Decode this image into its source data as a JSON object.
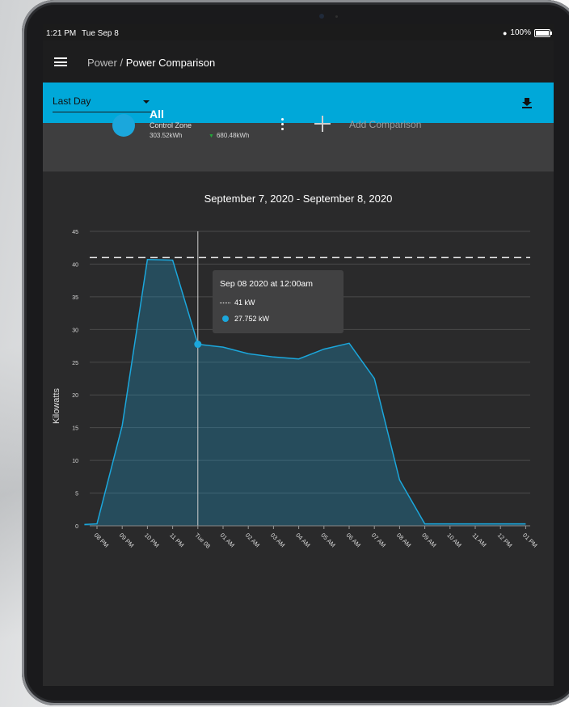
{
  "status": {
    "time": "1:21 PM",
    "date": "Tue Sep 8",
    "battery": "100%"
  },
  "appbar": {
    "section": "Power /",
    "page": "Power Comparison"
  },
  "filter": {
    "range_selected": "Last Day"
  },
  "comparison": {
    "zone_name": "All",
    "zone_type": "Control Zone",
    "energy": "303.52kWh",
    "trend_value": "680.48kWh",
    "add_label": "Add Comparison"
  },
  "colors": {
    "accent": "#00a8d9",
    "series": "#1ba7dc",
    "trend_down": "#22a63a",
    "background": "#2a2a2b"
  },
  "icons": [
    "menu-icon",
    "chevron-down-icon",
    "download-icon",
    "more-vertical-icon",
    "plus-icon",
    "wifi-icon",
    "battery-icon"
  ],
  "chart_data": {
    "type": "area",
    "title": "September 7, 2020 - September 8, 2020",
    "ylabel": "Kilowatts",
    "ylim": [
      0,
      45
    ],
    "yticks": [
      "0",
      "5",
      "10",
      "15",
      "20",
      "25",
      "30",
      "35",
      "40",
      "45"
    ],
    "x_tick_labels": [
      "08 PM",
      "09 PM",
      "10 PM",
      "11 PM",
      "Tue 08",
      "01 AM",
      "02 AM",
      "03 AM",
      "04 AM",
      "05 AM",
      "06 AM",
      "07 AM",
      "08 AM",
      "09 AM",
      "10 AM",
      "11 AM",
      "12 PM",
      "01 PM"
    ],
    "threshold": 41,
    "grid": true,
    "series": [
      {
        "x": [
          -0.5,
          0,
          1,
          2,
          3,
          4,
          5,
          6,
          7,
          8,
          9,
          10,
          11,
          12,
          13,
          14,
          15,
          16,
          17
        ],
        "values": [
          0.2,
          0.3,
          15.3,
          40.7,
          40.6,
          27.752,
          27.3,
          26.3,
          25.8,
          25.5,
          27.0,
          27.9,
          22.5,
          7.0,
          0.3,
          0.3,
          0.3,
          0.3,
          0.3
        ]
      }
    ],
    "tooltip": {
      "title": "Sep 08 2020 at 12:00am",
      "threshold_label": "41 kW",
      "value_label": "27.752 kW",
      "x": 4
    }
  }
}
